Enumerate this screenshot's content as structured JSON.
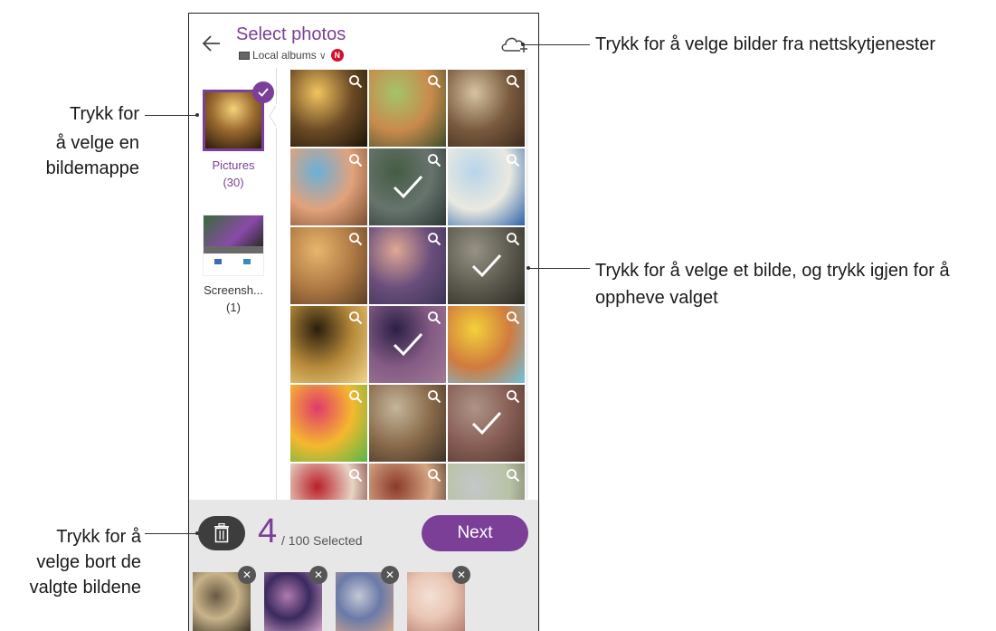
{
  "header": {
    "title": "Select photos",
    "source_label": "Local albums",
    "new_badge": "N"
  },
  "albums": [
    {
      "name": "Pictures",
      "count": "(30)",
      "selected": true
    },
    {
      "name": "Screensh...",
      "count": "(1)",
      "selected": false
    }
  ],
  "photos": [
    {
      "colors": [
        "#f2c45e",
        "#6b4a25",
        "#1d1408"
      ],
      "selected": false
    },
    {
      "colors": [
        "#a3c46a",
        "#c98a4c",
        "#3b4f2a"
      ],
      "selected": false
    },
    {
      "colors": [
        "#d6c3a2",
        "#7a5a3e",
        "#3b2a1c"
      ],
      "selected": false
    },
    {
      "colors": [
        "#6ab0d8",
        "#e2a27c",
        "#7a4e2e"
      ],
      "selected": false
    },
    {
      "colors": [
        "#5b7c5a",
        "#8a9a92",
        "#3a4a44"
      ],
      "selected": true
    },
    {
      "colors": [
        "#b8d4ea",
        "#e9e9e0",
        "#2c63a8"
      ],
      "selected": false
    },
    {
      "colors": [
        "#e8b66e",
        "#b07a44",
        "#5b3e22"
      ],
      "selected": false
    },
    {
      "colors": [
        "#e0a894",
        "#6a4e7c",
        "#3b3454"
      ],
      "selected": false
    },
    {
      "colors": [
        "#c8c4b2",
        "#7d7a6a",
        "#3c3a30"
      ],
      "selected": true
    },
    {
      "colors": [
        "#2a1e0e",
        "#b78a3a",
        "#f2d58a"
      ],
      "selected": false
    },
    {
      "colors": [
        "#3a2a5e",
        "#b07ab0",
        "#d6a4c8"
      ],
      "selected": true
    },
    {
      "colors": [
        "#f3d23a",
        "#d17a3e",
        "#6cc4e4"
      ],
      "selected": false
    },
    {
      "colors": [
        "#e03a6c",
        "#f5b82e",
        "#54b848"
      ],
      "selected": false
    },
    {
      "colors": [
        "#c4b69c",
        "#8a6a4a",
        "#3c3226"
      ],
      "selected": false
    },
    {
      "colors": [
        "#e9c6b4",
        "#b57e72",
        "#6e4a3e"
      ],
      "selected": true
    },
    {
      "colors": [
        "#b8202a",
        "#e8d4c4",
        "#5a1212"
      ],
      "selected": false
    },
    {
      "colors": [
        "#8a3a2a",
        "#d6a684",
        "#2a1a12"
      ],
      "selected": false
    },
    {
      "colors": [
        "#c4c8ca",
        "#b8c2a4",
        "#6a6e5c"
      ],
      "selected": false
    }
  ],
  "bottom_bar": {
    "selected_count": "4",
    "selected_total": "/ 100 Selected",
    "next_label": "Next"
  },
  "selected_chips": [
    {
      "colors": [
        "#c8b48a",
        "#6a5a44",
        "#3a3024"
      ]
    },
    {
      "colors": [
        "#3a2a5e",
        "#b07ab0",
        "#d6a4c8"
      ]
    },
    {
      "colors": [
        "#6a7aa8",
        "#c4c8d4",
        "#d6a88a"
      ]
    },
    {
      "colors": [
        "#e9c6b4",
        "#f2e0d6",
        "#b57e72"
      ]
    }
  ],
  "callouts": {
    "cloud": "Trykk for å velge bilder fra nettskytjenester",
    "folder_line1": "Trykk for",
    "folder_line2": "å velge en",
    "folder_line3": "bildemappe",
    "photo_line1": "Trykk for å velge et bilde, og trykk igjen for å",
    "photo_line2": "oppheve valget",
    "deselect_line1": "Trykk for å",
    "deselect_line2": "velge bort de",
    "deselect_line3": "valgte bildene"
  },
  "icons": {
    "back": "back-arrow-icon",
    "cloud": "cloud-add-icon",
    "zoom": "magnifier-icon",
    "trash": "trash-icon",
    "check": "check-icon",
    "remove": "close-icon"
  },
  "accent_color": "#7b3f98"
}
